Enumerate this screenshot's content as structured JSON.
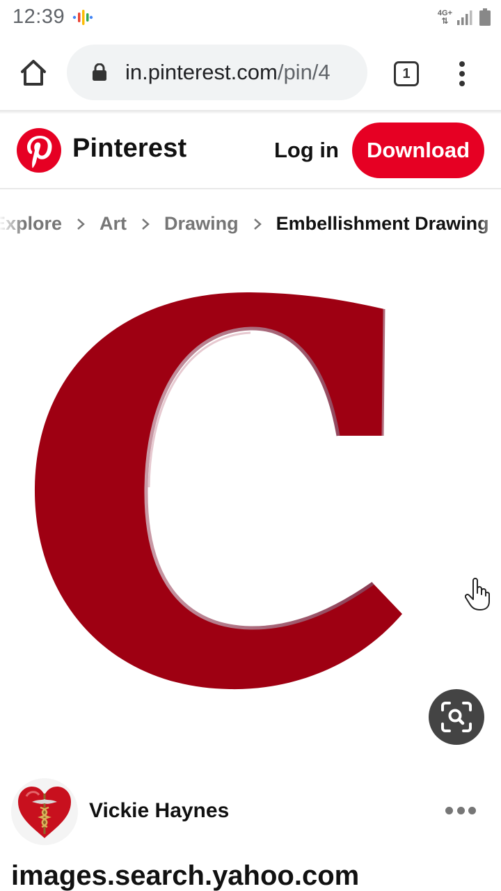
{
  "status_bar": {
    "time": "12:39",
    "network_type": "4G+",
    "icons": [
      "podcast-icon",
      "signal-icon",
      "battery-icon"
    ]
  },
  "browser": {
    "url_domain": "in.pinterest.com",
    "url_path": "/pin/4",
    "tab_count": "1",
    "icons": [
      "home-icon",
      "lock-icon",
      "tabs-icon",
      "overflow-menu-icon"
    ]
  },
  "header": {
    "brand": "Pinterest",
    "login_label": "Log in",
    "download_label": "Download",
    "brand_color": "#e60023"
  },
  "breadcrumb": {
    "items": [
      "Explore",
      "Art",
      "Drawing",
      "Embellishment Drawing"
    ]
  },
  "pin": {
    "image_subject": "red-letter-c",
    "letter": "C",
    "letter_color": "#9e0012"
  },
  "author": {
    "name": "Vickie Haynes"
  },
  "source": {
    "domain": "images.search.yahoo.com"
  }
}
